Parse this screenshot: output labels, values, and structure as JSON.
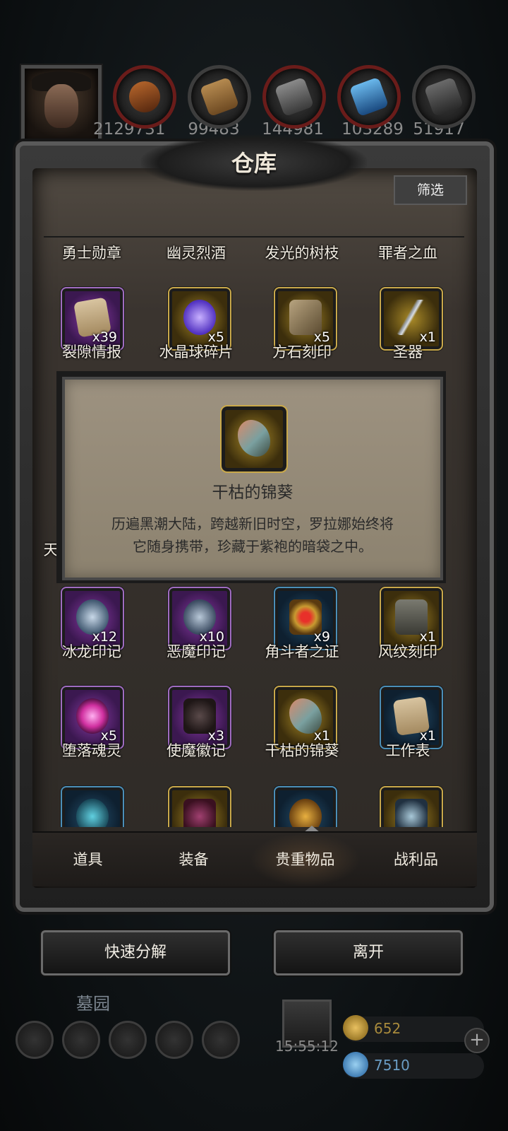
{
  "header": {
    "resources": [
      {
        "icon": "hero-avatar",
        "value": "2129731"
      },
      {
        "icon": "ore-pot-icon",
        "value": "99483"
      },
      {
        "icon": "wood-planks-icon",
        "value": "144981"
      },
      {
        "icon": "iron-ingots-icon",
        "value": "103289"
      },
      {
        "icon": "crystal-icon",
        "value": "51917"
      }
    ]
  },
  "panel": {
    "title": "仓库",
    "filter_label": "筛选",
    "row0_labels": [
      "勇士勋章",
      "幽灵烈酒",
      "发光的树枝",
      "罪者之血"
    ],
    "row1": [
      {
        "name": "裂隙情报",
        "qty": "x39",
        "rarity": "purple",
        "icon": "scroll-icon"
      },
      {
        "name": "水晶球碎片",
        "qty": "x5",
        "rarity": "gold",
        "icon": "crystal-shards-icon"
      },
      {
        "name": "方石刻印",
        "qty": "x5",
        "rarity": "gold",
        "icon": "stone-block-icon"
      },
      {
        "name": "圣器",
        "qty": "x1",
        "rarity": "gold",
        "icon": "holy-blade-icon"
      }
    ],
    "partial_left_label": "天",
    "row4": [
      {
        "name": "冰龙印记",
        "qty": "x12",
        "rarity": "purple",
        "icon": "ice-dragon-mark-icon"
      },
      {
        "name": "恶魔印记",
        "qty": "x10",
        "rarity": "purple",
        "icon": "demon-mark-icon"
      },
      {
        "name": "角斗者之证",
        "qty": "x9",
        "rarity": "blue",
        "icon": "gladiator-badge-icon"
      },
      {
        "name": "风纹刻印",
        "qty": "x1",
        "rarity": "gold",
        "icon": "wind-rune-icon"
      }
    ],
    "row5": [
      {
        "name": "堕落魂灵",
        "qty": "x5",
        "rarity": "purple",
        "icon": "fallen-soul-icon"
      },
      {
        "name": "使魔徽记",
        "qty": "x3",
        "rarity": "purple",
        "icon": "familiar-emblem-icon"
      },
      {
        "name": "干枯的锦葵",
        "qty": "x1",
        "rarity": "gold",
        "icon": "dried-mallow-icon"
      },
      {
        "name": "工作表",
        "qty": "x1",
        "rarity": "blue",
        "icon": "worksheet-icon"
      }
    ]
  },
  "tooltip": {
    "item_name": "干枯的锦葵",
    "description_line1": "历遍黑潮大陆，跨越新旧时空，罗拉娜始终将",
    "description_line2": "它随身携带，珍藏于紫袍的暗袋之中。"
  },
  "tabs": [
    {
      "label": "道具",
      "active": false
    },
    {
      "label": "装备",
      "active": false
    },
    {
      "label": "贵重物品",
      "active": true
    },
    {
      "label": "战利品",
      "active": false
    }
  ],
  "buttons": {
    "quick_dismantle": "快速分解",
    "leave": "离开"
  },
  "footer": {
    "area_name": "墓园",
    "timer": "15:55:12",
    "gold": "652",
    "gems": "7510",
    "plus": "+"
  },
  "colors": {
    "gold_text": "#a88a3c",
    "gem_text": "#6a9cc4",
    "purple_frame": "#a06cc0",
    "gold_frame": "#c9a84a",
    "blue_frame": "#4b8fb8"
  }
}
